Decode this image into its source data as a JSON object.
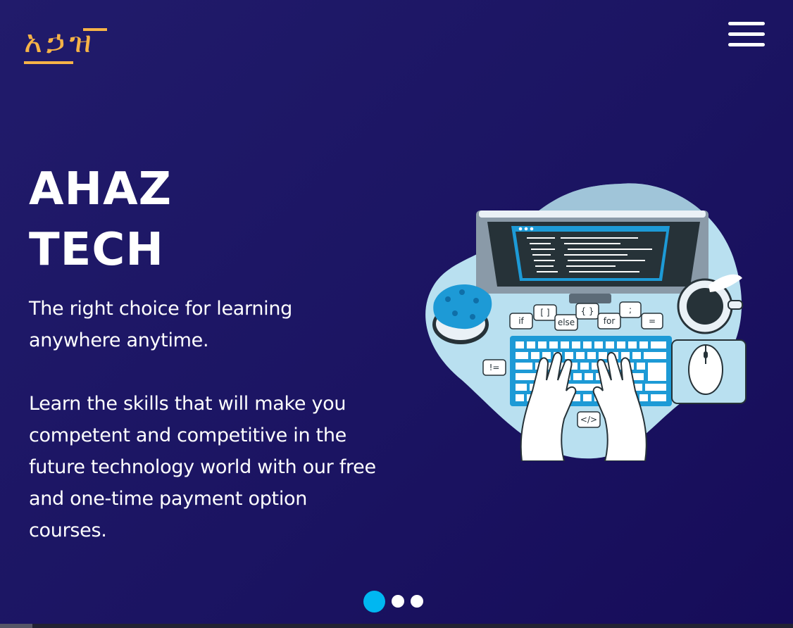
{
  "header": {
    "logo_text": "አኃዝ",
    "menu_icon": "hamburger-menu-icon"
  },
  "hero": {
    "title_line1": "AHAZ",
    "title_line2": "TECH",
    "tagline": "The right choice for learning anywhere anytime.",
    "body": "Learn the skills that will make you competent and competitive in the future technology world with our free and one-time payment option courses."
  },
  "illustration": {
    "subject": "coding-laptop-illustration",
    "code_bubbles": [
      "if",
      "[ ]",
      "else",
      "{ }",
      "for",
      ";",
      "=",
      "!=",
      "</>"
    ]
  },
  "carousel": {
    "slides_total": 3,
    "active_slide": 1
  },
  "colors": {
    "background": "#1d1566",
    "logo": "#f6b347",
    "active_dot": "#00b7f1",
    "blob": "#b9e0f0"
  }
}
